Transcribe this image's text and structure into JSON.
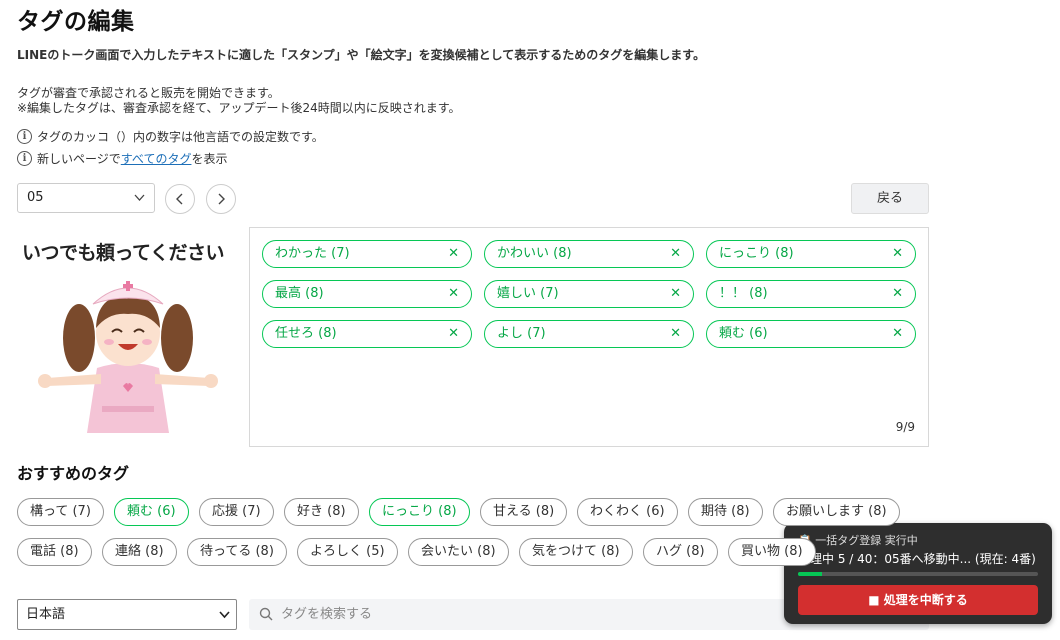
{
  "page": {
    "title": "タグの編集",
    "description": "LINEのトーク画面で入力したテキストに適した「スタンプ」や「絵文字」を変換候補として表示するためのタグを編集します。",
    "note1": "タグが審査で承認されると販売を開始できます。",
    "note2": "※編集したタグは、審査承認を経て、アップデート後24時間以内に反映されます。",
    "info1": "タグのカッコ（）内の数字は他言語での設定数です。",
    "info2_prefix": "新しいページで",
    "info2_link": "すべてのタグ",
    "info2_suffix": "を表示"
  },
  "toolbar": {
    "sticker_select": "05",
    "back_label": "戻る"
  },
  "sticker": {
    "caption": "いつでも頼ってください"
  },
  "selected_tags": [
    "わかった (7)",
    "かわいい (8)",
    "にっこり (8)",
    "最高 (8)",
    "嬉しい (7)",
    "！！ (8)",
    "任せろ (8)",
    "よし (7)",
    "頼む (6)"
  ],
  "selected_count": "9/9",
  "recommended": {
    "title": "おすすめのタグ",
    "row1": [
      {
        "label": "構って (7)",
        "on": false
      },
      {
        "label": "頼む (6)",
        "on": true
      },
      {
        "label": "応援 (7)",
        "on": false
      },
      {
        "label": "好き (8)",
        "on": false
      },
      {
        "label": "にっこり (8)",
        "on": true
      },
      {
        "label": "甘える (8)",
        "on": false
      },
      {
        "label": "わくわく (6)",
        "on": false
      },
      {
        "label": "期待 (8)",
        "on": false
      },
      {
        "label": "お願いします (8)",
        "on": false
      }
    ],
    "row2": [
      {
        "label": "電話 (8)",
        "on": false
      },
      {
        "label": "連絡 (8)",
        "on": false
      },
      {
        "label": "待ってる (8)",
        "on": false
      },
      {
        "label": "よろしく (5)",
        "on": false
      },
      {
        "label": "会いたい (8)",
        "on": false
      },
      {
        "label": "気をつけて (8)",
        "on": false
      },
      {
        "label": "ハグ (8)",
        "on": false
      },
      {
        "label": "買い物 (8)",
        "on": false
      }
    ]
  },
  "filters": {
    "language": "日本語",
    "search_placeholder": "タグを検索する"
  },
  "toast": {
    "title": "📋 一括タグ登録 実行中",
    "status": "処理中 5 / 40：05番へ移動中... (現在: 4番)",
    "progress": 0.1,
    "stop_label": "■ 処理を中断する"
  },
  "colors": {
    "accent": "#06c755",
    "stop": "#d32f2f"
  }
}
